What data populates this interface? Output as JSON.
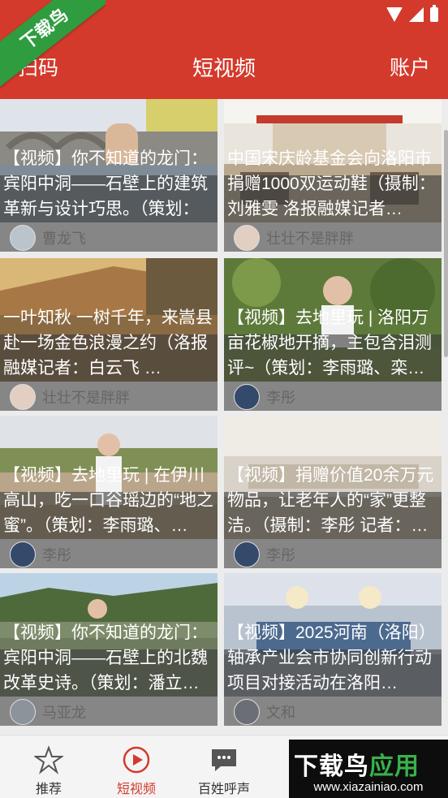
{
  "header": {
    "left_label": "扫码",
    "title": "短视频",
    "right_label": "账户"
  },
  "corner_banner": "下载鸟",
  "videos": [
    {
      "title": "【视频】你不知道的龙门：宾阳中洞——石壁上的建筑革新与设计巧思。（策划：潘立龙 …",
      "author": "曹龙飞"
    },
    {
      "title": "中国宋庆龄基金会向洛阳市捐赠1000双运动鞋（摄制：刘雅雯 洛报融媒记者…",
      "author": "壮壮不是胖胖"
    },
    {
      "title": "一叶知秋 一树千年，来嵩县赴一场金色浪漫之约（洛报融媒记者：白云飞 …",
      "author": "壮壮不是胖胖"
    },
    {
      "title": "【视频】去地里玩 | 洛阳万亩花椒地开摘，主包含泪测评~（策划：李雨璐、栾…",
      "author": "李彤"
    },
    {
      "title": "【视频】去地里玩 | 在伊川高山，吃一口谷瑶边的“地之蜜”。（策划：李雨璐、…",
      "author": "李彤"
    },
    {
      "title": "【视频】捐赠价值20余万元物品，让老年人的“家”更整洁。（摄制：李彤 记者：…",
      "author": "李彤"
    },
    {
      "title": "【视频】你不知道的龙门：宾阳中洞——石壁上的北魏改革史诗。（策划：潘立…",
      "author": "马亚龙"
    },
    {
      "title": "【视频】2025河南（洛阳）轴承产业会市协同创新行动项目对接活动在洛阳…",
      "author": "文和"
    }
  ],
  "bottom_nav": [
    {
      "label": "推荐",
      "icon": "star-icon"
    },
    {
      "label": "短视频",
      "icon": "play-circle-icon"
    },
    {
      "label": "百姓呼声",
      "icon": "chat-bubble-icon"
    }
  ],
  "watermark": {
    "title_part1": "下载鸟",
    "title_part2": "应用",
    "url": "www.xiazainiao.com"
  },
  "colors": {
    "brand_red": "#d33a2c",
    "nav_active": "#d33a2c",
    "corner_green": "#2e9c3f"
  }
}
